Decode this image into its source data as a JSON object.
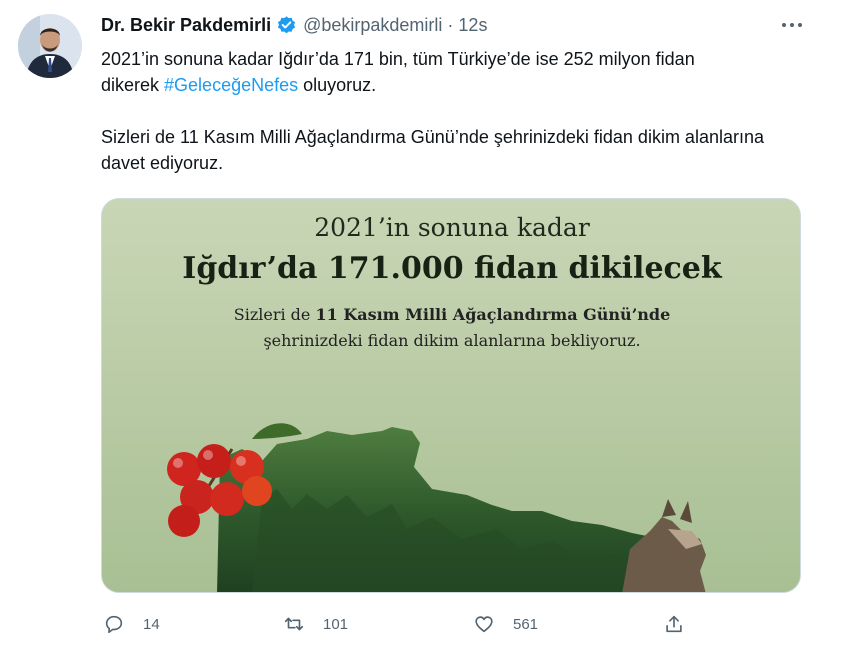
{
  "tweet": {
    "author_name": "Dr. Bekir Pakdemirli",
    "handle": "@bekirpakdemirli",
    "separator": "·",
    "time": "12s",
    "text_line1_a": "2021’in sonuna kadar Iğdır’da 171 bin, tüm Türkiye’de ise 252 milyon fidan",
    "text_line2_a": "dikerek ",
    "hashtag": "#GeleceğeNefes",
    "text_line2_b": " oluyoruz.",
    "text_para2": "Sizleri de 11 Kasım Milli Ağaçlandırma Günü’nde şehrinizdeki fidan dikim alanlarına davet ediyoruz."
  },
  "media": {
    "line1": "2021’in sonuna kadar",
    "line2": "Iğdır’da 171.000 fidan dikilecek",
    "line3_a": "Sizleri de ",
    "line3_bold": "11 Kasım Milli Ağaçlandırma Günü’nde",
    "line4": "şehrinizdeki fidan dikim alanlarına bekliyoruz."
  },
  "actions": {
    "reply_count": "14",
    "retweet_count": "101",
    "like_count": "561"
  },
  "icons": {
    "verified": "verified-badge-icon",
    "more": "more-dots-icon",
    "reply": "reply-icon",
    "retweet": "retweet-icon",
    "like": "heart-icon",
    "share": "share-icon"
  },
  "colors": {
    "accent": "#1d9bf0",
    "muted": "#536471",
    "media_bg": "#b4c7a2",
    "forest": "#2f5a2c",
    "berry": "#d0251f"
  }
}
